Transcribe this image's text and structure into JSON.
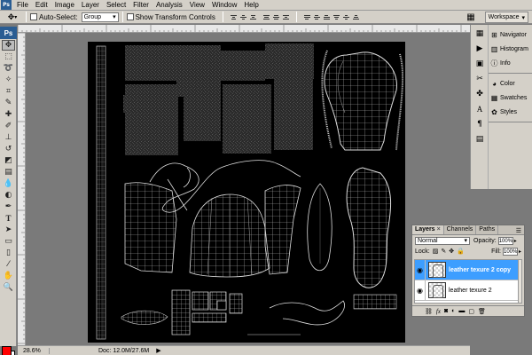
{
  "menubar": {
    "items": [
      "File",
      "Edit",
      "Image",
      "Layer",
      "Select",
      "Filter",
      "Analysis",
      "View",
      "Window",
      "Help"
    ]
  },
  "options": {
    "auto_select_label": "Auto-Select:",
    "auto_select_value": "Group",
    "show_transform_label": "Show Transform Controls",
    "workspace_label": "Workspace"
  },
  "toolbox": {
    "logo": "Ps",
    "foreground_color": "#ff0000",
    "background_color": "#ffffff"
  },
  "status": {
    "zoom": "28.6%",
    "doc": "Doc: 12.0M/27.6M"
  },
  "dock": {
    "group1": [
      "Navigator",
      "Histogram",
      "Info"
    ],
    "group2": [
      "Color",
      "Swatches",
      "Styles"
    ]
  },
  "layers_panel": {
    "tabs": [
      "Layers",
      "Channels",
      "Paths"
    ],
    "blend_mode": "Normal",
    "opacity_label": "Opacity:",
    "opacity": "100%",
    "lock_label": "Lock:",
    "fill_label": "Fill:",
    "fill": "100%",
    "layers": [
      {
        "name": "leather texure 2 copy",
        "selected": true,
        "visible": true
      },
      {
        "name": "leather texure 2",
        "selected": false,
        "visible": true
      }
    ]
  },
  "colors": {
    "selection": "#3d9eff",
    "chrome": "#d4d0c8",
    "workspace_bg": "#7a7a7a",
    "canvas": "#000000"
  }
}
